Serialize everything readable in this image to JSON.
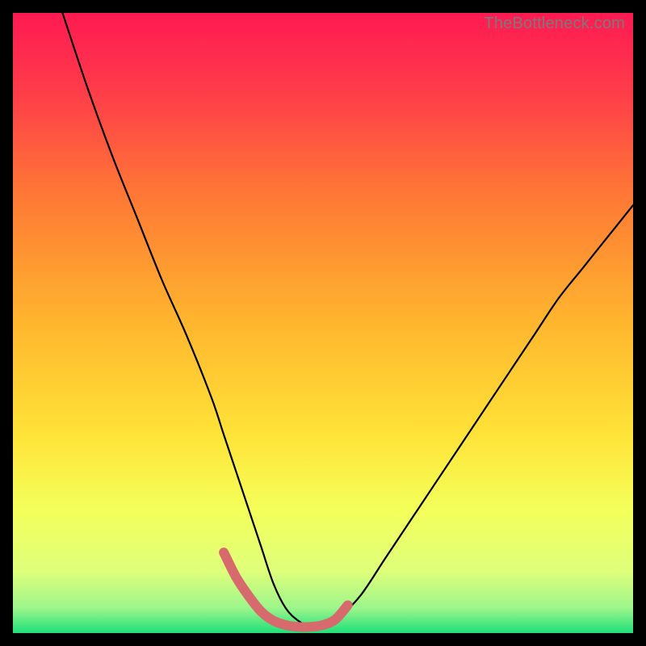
{
  "watermark": "TheBottleneck.com",
  "colors": {
    "black": "#000000",
    "curve": "#000000",
    "highlight": "#d66a6c",
    "grad_top": "#ff1a52",
    "grad_mid1": "#ff8a2a",
    "grad_mid2": "#ffe338",
    "grad_mid3": "#f7ff66",
    "grad_bottom": "#1fe07a"
  },
  "chart_data": {
    "type": "line",
    "title": "",
    "xlabel": "",
    "ylabel": "",
    "xlim": [
      0,
      100
    ],
    "ylim": [
      0,
      100
    ],
    "series": [
      {
        "name": "bottleneck-curve",
        "x": [
          8,
          12,
          16,
          20,
          24,
          28,
          32,
          34,
          36,
          38,
          40,
          42,
          44,
          46,
          48,
          50,
          52,
          56,
          60,
          64,
          68,
          72,
          76,
          80,
          84,
          88,
          92,
          96,
          100
        ],
        "y": [
          100,
          88,
          77,
          67,
          57,
          48,
          38,
          32,
          26,
          20,
          14,
          8,
          4,
          2,
          1,
          1,
          2,
          6,
          12,
          18,
          24,
          30,
          36,
          42,
          48,
          54,
          59,
          64,
          69
        ]
      }
    ],
    "highlight_region": {
      "name": "optimal-zone",
      "x": [
        34,
        36,
        38,
        40,
        42,
        44,
        46,
        48,
        50,
        52,
        54
      ],
      "y": [
        13,
        9,
        6,
        3.5,
        2,
        1.3,
        1,
        1,
        1.3,
        2.2,
        4.5
      ]
    },
    "gradient_stops": [
      {
        "offset": 0.0,
        "color": "#ff1a52"
      },
      {
        "offset": 0.12,
        "color": "#ff3a4a"
      },
      {
        "offset": 0.3,
        "color": "#ff7a35"
      },
      {
        "offset": 0.5,
        "color": "#ffb62e"
      },
      {
        "offset": 0.68,
        "color": "#ffe338"
      },
      {
        "offset": 0.8,
        "color": "#f4ff5a"
      },
      {
        "offset": 0.9,
        "color": "#dfff7a"
      },
      {
        "offset": 0.96,
        "color": "#9cf58b"
      },
      {
        "offset": 1.0,
        "color": "#1fe07a"
      }
    ]
  }
}
